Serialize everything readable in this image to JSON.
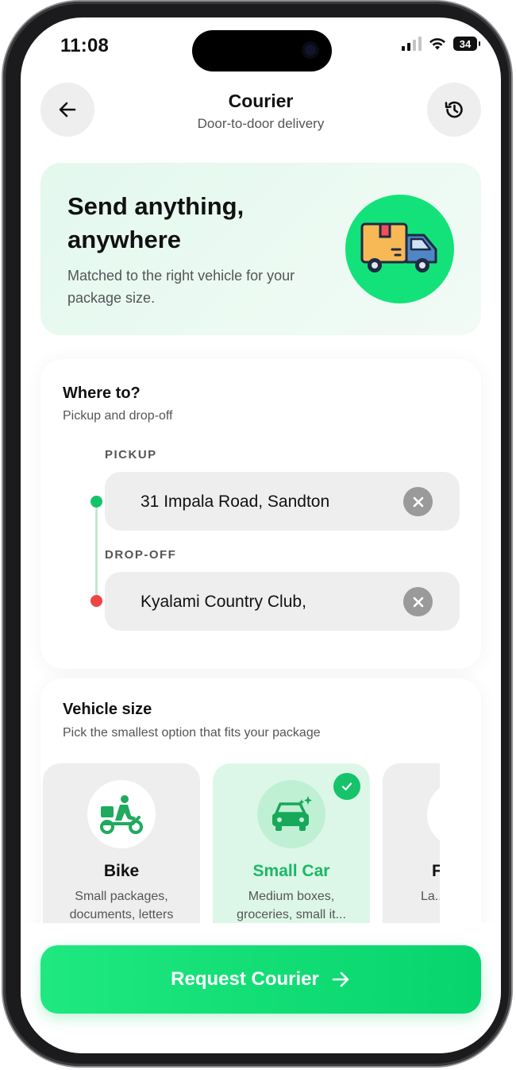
{
  "status_bar": {
    "time": "11:08",
    "battery": "34"
  },
  "header": {
    "title": "Courier",
    "subtitle": "Door-to-door delivery"
  },
  "hero": {
    "title": "Send anything, anywhere",
    "subtitle": "Matched to the right vehicle for your package size."
  },
  "route": {
    "title": "Where to?",
    "subtitle": "Pickup and drop-off",
    "pickup_label": "PICKUP",
    "pickup_value": "31 Impala Road, Sandton",
    "dropoff_label": "DROP-OFF",
    "dropoff_value": "Kyalami Country Club,"
  },
  "vehicle": {
    "title": "Vehicle size",
    "subtitle": "Pick the smallest option that fits your package",
    "options": [
      {
        "name": "Bike",
        "desc": "Small packages, documents, letters",
        "selected": false,
        "icon": "scooter-courier-icon"
      },
      {
        "name": "Small Car",
        "desc": "Medium boxes, groceries, small it...",
        "selected": true,
        "icon": "car-icon"
      },
      {
        "name": "F",
        "desc": "La... mu...",
        "selected": false,
        "icon": "vehicle-icon"
      }
    ]
  },
  "cta": {
    "label": "Request Courier"
  },
  "colors": {
    "accent": "#13E27A",
    "accent_text": "#1BB864",
    "dropoff_dot": "#EF4444"
  }
}
